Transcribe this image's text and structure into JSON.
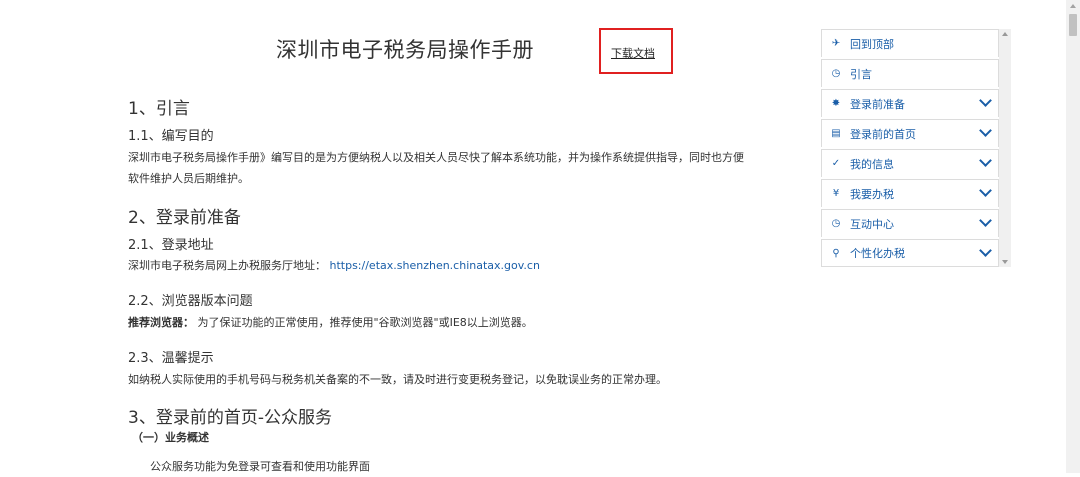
{
  "doc": {
    "title": "深圳市电子税务局操作手册",
    "download_label": "下载文档",
    "h_intro": "1、引言",
    "h_intro_purpose": "1.1、编写目的",
    "p_purpose_1": "深圳市电子税务局操作手册》编写目的是为方便纳税人以及相关人员尽快了解本系统功能，并为操作系统提供指导，同时也方便",
    "p_purpose_2": "软件维护人员后期维护。",
    "h_prep": "2、登录前准备",
    "h_login_addr": "2.1、登录地址",
    "p_login_addr": "深圳市电子税务局网上办税服务厅地址：",
    "login_url": "https://etax.shenzhen.chinatax.gov.cn",
    "h_browser": "2.2、浏览器版本问题",
    "browser_bold": "推荐浏览器：",
    "browser_text": "为了保证功能的正常使用，推荐使用\"谷歌浏览器\"或IE8以上浏览器。",
    "h_tips": "2.3、温馨提示",
    "p_tips": "如纳税人实际使用的手机号码与税务机关备案的不一致，请及时进行变更税务登记，以免耽误业务的正常办理。",
    "h_home": "3、登录前的首页-公众服务",
    "h_overview": "（一）业务概述",
    "p_overview": "公众服务功能为免登录可查看和使用功能界面"
  },
  "sidebar": {
    "items": [
      {
        "label": "回到顶部",
        "icon": "plane-icon",
        "glyph": "✈",
        "expandable": false
      },
      {
        "label": "引言",
        "icon": "clock-icon",
        "glyph": "◷",
        "expandable": false
      },
      {
        "label": "登录前准备",
        "icon": "gear-icon",
        "glyph": "✸",
        "expandable": true
      },
      {
        "label": "登录前的首页",
        "icon": "list-icon",
        "glyph": "▤",
        "expandable": true
      },
      {
        "label": "我的信息",
        "icon": "check-icon",
        "glyph": "✓",
        "expandable": true
      },
      {
        "label": "我要办税",
        "icon": "yen-icon",
        "glyph": "¥",
        "expandable": true
      },
      {
        "label": "互动中心",
        "icon": "clock-icon",
        "glyph": "◷",
        "expandable": true
      },
      {
        "label": "个性化办税",
        "icon": "search-icon",
        "glyph": "⚲",
        "expandable": true
      }
    ]
  },
  "colors": {
    "accent": "#1a5ea8",
    "highlight_box": "#e02020"
  }
}
